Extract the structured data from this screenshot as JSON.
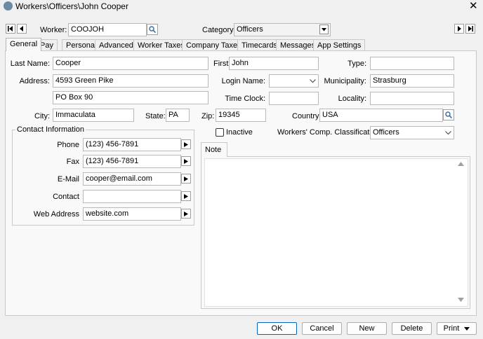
{
  "window": {
    "title": "Workers\\Officers\\John Cooper"
  },
  "header": {
    "worker_label": "Worker:",
    "worker_value": "COOJOH",
    "category_label": "Category:",
    "category_value": "Officers"
  },
  "tabs": [
    "General",
    "Pay",
    "Personal",
    "Advanced",
    "Worker Taxes",
    "Company Taxes",
    "Timecards",
    "Messages",
    "App Settings"
  ],
  "form": {
    "last_name_label": "Last Name:",
    "last_name": "Cooper",
    "first_label": "First:",
    "first": "John",
    "type_label": "Type:",
    "type": "",
    "address_label": "Address:",
    "address1": "4593 Green Pike",
    "address2": "PO Box 90",
    "login_label": "Login Name:",
    "login": "",
    "municipality_label": "Municipality:",
    "municipality": "Strasburg",
    "timeclock_label": "Time Clock:",
    "timeclock": "",
    "locality_label": "Locality:",
    "locality": "",
    "city_label": "City:",
    "city": "Immaculata",
    "state_label": "State:",
    "state": "PA",
    "zip_label": "Zip:",
    "zip": "19345",
    "country_label": "Country:",
    "country": "USA",
    "inactive_label": "Inactive",
    "wcc_label": "Workers' Comp. Classification:",
    "wcc_value": "Officers"
  },
  "contact": {
    "group_label": "Contact Information",
    "phone_label": "Phone",
    "phone": "(123) 456-7891",
    "fax_label": "Fax",
    "fax": "(123) 456-7891",
    "email_label": "E-Mail",
    "email": "cooper@email.com",
    "contact_label": "Contact",
    "contact": "",
    "web_label": "Web Address",
    "web": "website.com"
  },
  "note": {
    "tab_label": "Note"
  },
  "buttons": {
    "ok": "OK",
    "cancel": "Cancel",
    "new": "New",
    "delete": "Delete",
    "print": "Print"
  }
}
